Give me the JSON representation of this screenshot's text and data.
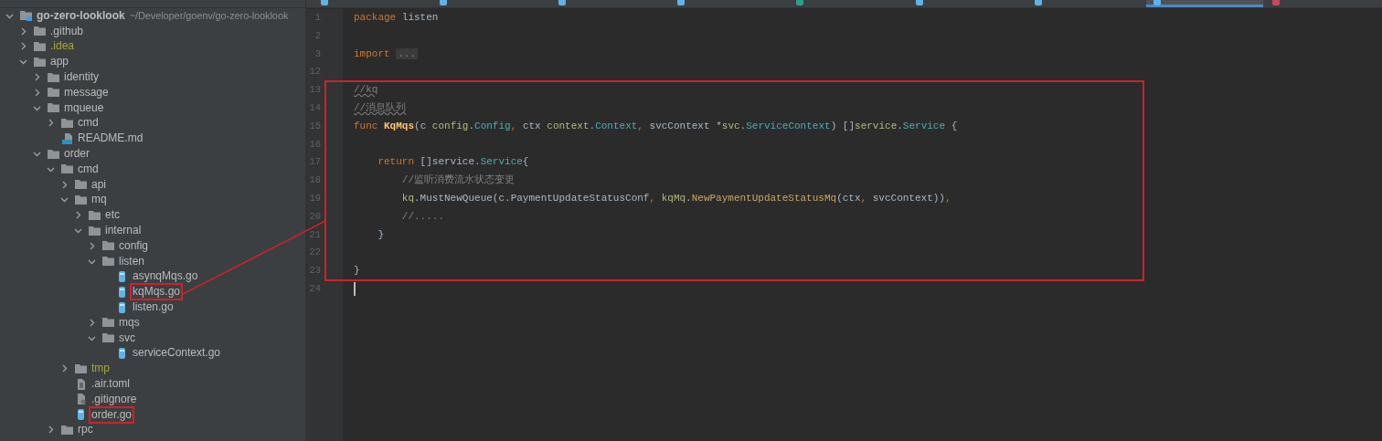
{
  "project_tree": {
    "root": {
      "name": "go-zero-looklook",
      "path": "~/Developer/goenv/go-zero-looklook",
      "expanded": true,
      "children": [
        {
          "name": ".github",
          "kind": "folder",
          "expanded": false,
          "excluded": false
        },
        {
          "name": ".idea",
          "kind": "folder",
          "expanded": false,
          "excluded": true
        },
        {
          "name": "app",
          "kind": "folder",
          "expanded": true,
          "excluded": false,
          "children": [
            {
              "name": "identity",
              "kind": "folder",
              "expanded": false,
              "excluded": false
            },
            {
              "name": "message",
              "kind": "folder",
              "expanded": false,
              "excluded": false
            },
            {
              "name": "mqueue",
              "kind": "folder",
              "expanded": true,
              "excluded": false,
              "children": [
                {
                  "name": "cmd",
                  "kind": "folder",
                  "expanded": false,
                  "excluded": false
                },
                {
                  "name": "README.md",
                  "kind": "markdown",
                  "highlighted": false
                }
              ]
            },
            {
              "name": "order",
              "kind": "folder",
              "expanded": true,
              "excluded": false,
              "children": [
                {
                  "name": "cmd",
                  "kind": "folder",
                  "expanded": true,
                  "excluded": false,
                  "children": [
                    {
                      "name": "api",
                      "kind": "folder",
                      "expanded": false,
                      "excluded": false
                    },
                    {
                      "name": "mq",
                      "kind": "folder",
                      "expanded": true,
                      "excluded": false,
                      "children": [
                        {
                          "name": "etc",
                          "kind": "folder",
                          "expanded": false,
                          "excluded": false
                        },
                        {
                          "name": "internal",
                          "kind": "folder",
                          "expanded": true,
                          "excluded": false,
                          "children": [
                            {
                              "name": "config",
                              "kind": "folder",
                              "expanded": false,
                              "excluded": false
                            },
                            {
                              "name": "listen",
                              "kind": "folder",
                              "expanded": true,
                              "excluded": false,
                              "children": [
                                {
                                  "name": "asynqMqs.go",
                                  "kind": "go",
                                  "highlighted": false
                                },
                                {
                                  "name": "kqMqs.go",
                                  "kind": "go",
                                  "highlighted": true,
                                  "linked_to_code": true
                                },
                                {
                                  "name": "listen.go",
                                  "kind": "go",
                                  "highlighted": false
                                }
                              ]
                            },
                            {
                              "name": "mqs",
                              "kind": "folder",
                              "expanded": false,
                              "excluded": false
                            },
                            {
                              "name": "svc",
                              "kind": "folder",
                              "expanded": true,
                              "excluded": false,
                              "children": [
                                {
                                  "name": "serviceContext.go",
                                  "kind": "go",
                                  "highlighted": false
                                }
                              ]
                            }
                          ]
                        }
                      ]
                    },
                    {
                      "name": "tmp",
                      "kind": "folder",
                      "expanded": false,
                      "excluded": true
                    },
                    {
                      "name": ".air.toml",
                      "kind": "text",
                      "highlighted": false
                    },
                    {
                      "name": ".gitignore",
                      "kind": "ignore",
                      "highlighted": false
                    },
                    {
                      "name": "order.go",
                      "kind": "go",
                      "highlighted": true
                    }
                  ]
                },
                {
                  "name": "rpc",
                  "kind": "folder",
                  "expanded": false,
                  "excluded": false
                }
              ]
            }
          ]
        }
      ]
    }
  },
  "tabs": [
    {
      "kind": "go",
      "selected": false
    },
    {
      "kind": "go",
      "selected": false
    },
    {
      "kind": "go",
      "selected": false
    },
    {
      "kind": "go",
      "selected": false
    },
    {
      "kind": "proto",
      "selected": false
    },
    {
      "kind": "go",
      "selected": false
    },
    {
      "kind": "go",
      "selected": false
    },
    {
      "kind": "go",
      "selected": true
    },
    {
      "kind": "yaml",
      "selected": false
    }
  ],
  "editor": {
    "sections": [
      {
        "boxed": false,
        "lines": [
          {
            "number": "1",
            "cursor": false,
            "tokens": [
              {
                "kind": "kw",
                "text": "package"
              },
              {
                "kind": "plain",
                "text": " listen"
              }
            ]
          },
          {
            "number": "2",
            "cursor": false
          },
          {
            "number": "3",
            "cursor": false,
            "tokens": [
              {
                "kind": "kw",
                "text": "import"
              },
              {
                "kind": "fold",
                "text": "..."
              }
            ]
          },
          {
            "number": "12",
            "cursor": false
          }
        ]
      },
      {
        "boxed": true,
        "lines": [
          {
            "number": "13",
            "cursor": false,
            "tokens": [
              {
                "kind": "typo",
                "text": "//kq"
              }
            ]
          },
          {
            "number": "14",
            "cursor": false,
            "tokens": [
              {
                "kind": "typo",
                "text": "//消息队列"
              }
            ]
          },
          {
            "number": "15",
            "cursor": false,
            "tokens": [
              {
                "kind": "kw",
                "text": "func "
              },
              {
                "kind": "fn",
                "text": "KqMqs"
              },
              {
                "kind": "plain",
                "text": "(c "
              },
              {
                "kind": "pkg",
                "text": "config"
              },
              {
                "kind": "plain",
                "text": "."
              },
              {
                "kind": "type",
                "text": "Config"
              },
              {
                "kind": "kw",
                "text": ","
              },
              {
                "kind": "plain",
                "text": " ctx "
              },
              {
                "kind": "pkg",
                "text": "context"
              },
              {
                "kind": "plain",
                "text": "."
              },
              {
                "kind": "type",
                "text": "Context"
              },
              {
                "kind": "kw",
                "text": ","
              },
              {
                "kind": "plain",
                "text": " svcContext *"
              },
              {
                "kind": "pkg",
                "text": "svc"
              },
              {
                "kind": "plain",
                "text": "."
              },
              {
                "kind": "type",
                "text": "ServiceContext"
              },
              {
                "kind": "plain",
                "text": ") []"
              },
              {
                "kind": "pkg",
                "text": "service"
              },
              {
                "kind": "plain",
                "text": "."
              },
              {
                "kind": "type",
                "text": "Service"
              },
              {
                "kind": "plain",
                "text": " {"
              }
            ]
          },
          {
            "number": "16",
            "cursor": false
          },
          {
            "number": "17",
            "cursor": false,
            "tokens": [
              {
                "kind": "kw",
                "text": "    return"
              },
              {
                "kind": "plain",
                "text": " []service."
              },
              {
                "kind": "type",
                "text": "Service"
              },
              {
                "kind": "plain",
                "text": "{"
              }
            ]
          },
          {
            "number": "18",
            "cursor": false,
            "tokens": [
              {
                "kind": "comment",
                "text": "        //监听消费流水状态变更"
              }
            ]
          },
          {
            "number": "19",
            "cursor": false,
            "tokens": [
              {
                "kind": "pkg",
                "text": "        kq"
              },
              {
                "kind": "plain",
                "text": ".MustNewQueue(c.PaymentUpdateStatusConf"
              },
              {
                "kind": "kw",
                "text": ","
              },
              {
                "kind": "pkg",
                "text": " kqMq"
              },
              {
                "kind": "plain",
                "text": "."
              },
              {
                "kind": "call",
                "text": "NewPaymentUpdateStatusMq"
              },
              {
                "kind": "plain",
                "text": "(ctx"
              },
              {
                "kind": "kw",
                "text": ","
              },
              {
                "kind": "plain",
                "text": " svcContext))"
              },
              {
                "kind": "kw",
                "text": ","
              }
            ]
          },
          {
            "number": "20",
            "cursor": false,
            "tokens": [
              {
                "kind": "comment",
                "text": "        //....."
              }
            ]
          },
          {
            "number": "21",
            "cursor": false,
            "tokens": [
              {
                "kind": "plain",
                "text": "    }"
              }
            ]
          },
          {
            "number": "22",
            "cursor": false
          },
          {
            "number": "23",
            "cursor": false,
            "tokens": [
              {
                "kind": "plain",
                "text": "}"
              }
            ]
          }
        ]
      },
      {
        "boxed": false,
        "lines": [
          {
            "number": "24",
            "cursor": true
          }
        ]
      }
    ]
  }
}
